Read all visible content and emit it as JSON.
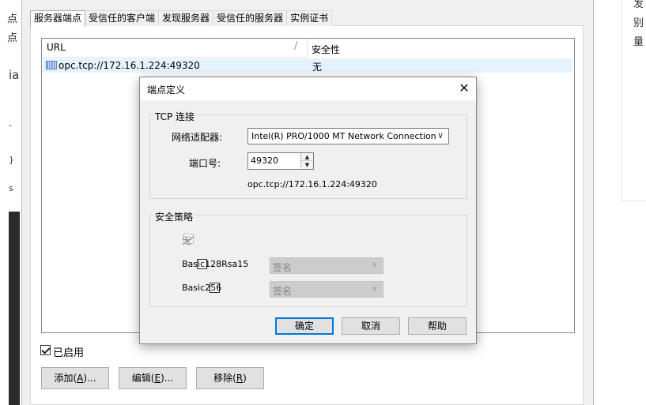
{
  "background": {
    "left_lines": [
      "点",
      "点"
    ],
    "left_marks": [
      "ia",
      "-",
      "}",
      "s"
    ],
    "right_lines": [
      "发",
      "别",
      "量"
    ]
  },
  "tabs": [
    {
      "label": "服务器端点",
      "active": true
    },
    {
      "label": "受信任的客户端",
      "active": false
    },
    {
      "label": "发现服务器",
      "active": false
    },
    {
      "label": "受信任的服务器",
      "active": false
    },
    {
      "label": "实例证书",
      "active": false
    }
  ],
  "endpoint_list": {
    "columns": {
      "url": "URL",
      "separator": "/",
      "security": "安全性"
    },
    "rows": [
      {
        "url": "opc.tcp://172.16.1.224:49320",
        "security": "无",
        "selected": true
      }
    ]
  },
  "enabled": {
    "label": "已启用",
    "checked": true
  },
  "buttons": {
    "add": {
      "text": "添加(",
      "accel": "A",
      "suffix": ")..."
    },
    "edit": {
      "text": "编辑(",
      "accel": "E",
      "suffix": ")..."
    },
    "remove": {
      "text": "移除(",
      "accel": "R",
      "suffix": ")"
    }
  },
  "dialog": {
    "title": "端点定义",
    "close_icon": "close-icon",
    "tcp_group": {
      "label": "TCP 连接",
      "adapter_label": "网络适配器:",
      "adapter_value": "Intel(R) PRO/1000 MT Network Connection",
      "port_label": "端口号:",
      "port_value": "49320",
      "endpoint_url": "opc.tcp://172.16.1.224:49320"
    },
    "security_group": {
      "label": "安全策略",
      "policies": [
        {
          "label": "无",
          "checked": true,
          "enabled": false
        },
        {
          "label": "Basic128Rsa15",
          "checked": false,
          "enabled": true,
          "mode": "签名",
          "mode_enabled": false
        },
        {
          "label": "Basic256",
          "checked": false,
          "enabled": true,
          "mode": "签名",
          "mode_enabled": false
        }
      ]
    },
    "ok_label": "确定",
    "cancel_label": "取消",
    "help_label": "帮助"
  },
  "colors": {
    "window_bg": "#f0f0f0",
    "selection": "#e5f3ff",
    "focus_border": "#0078d7",
    "disabled_bg": "#cccccc"
  }
}
